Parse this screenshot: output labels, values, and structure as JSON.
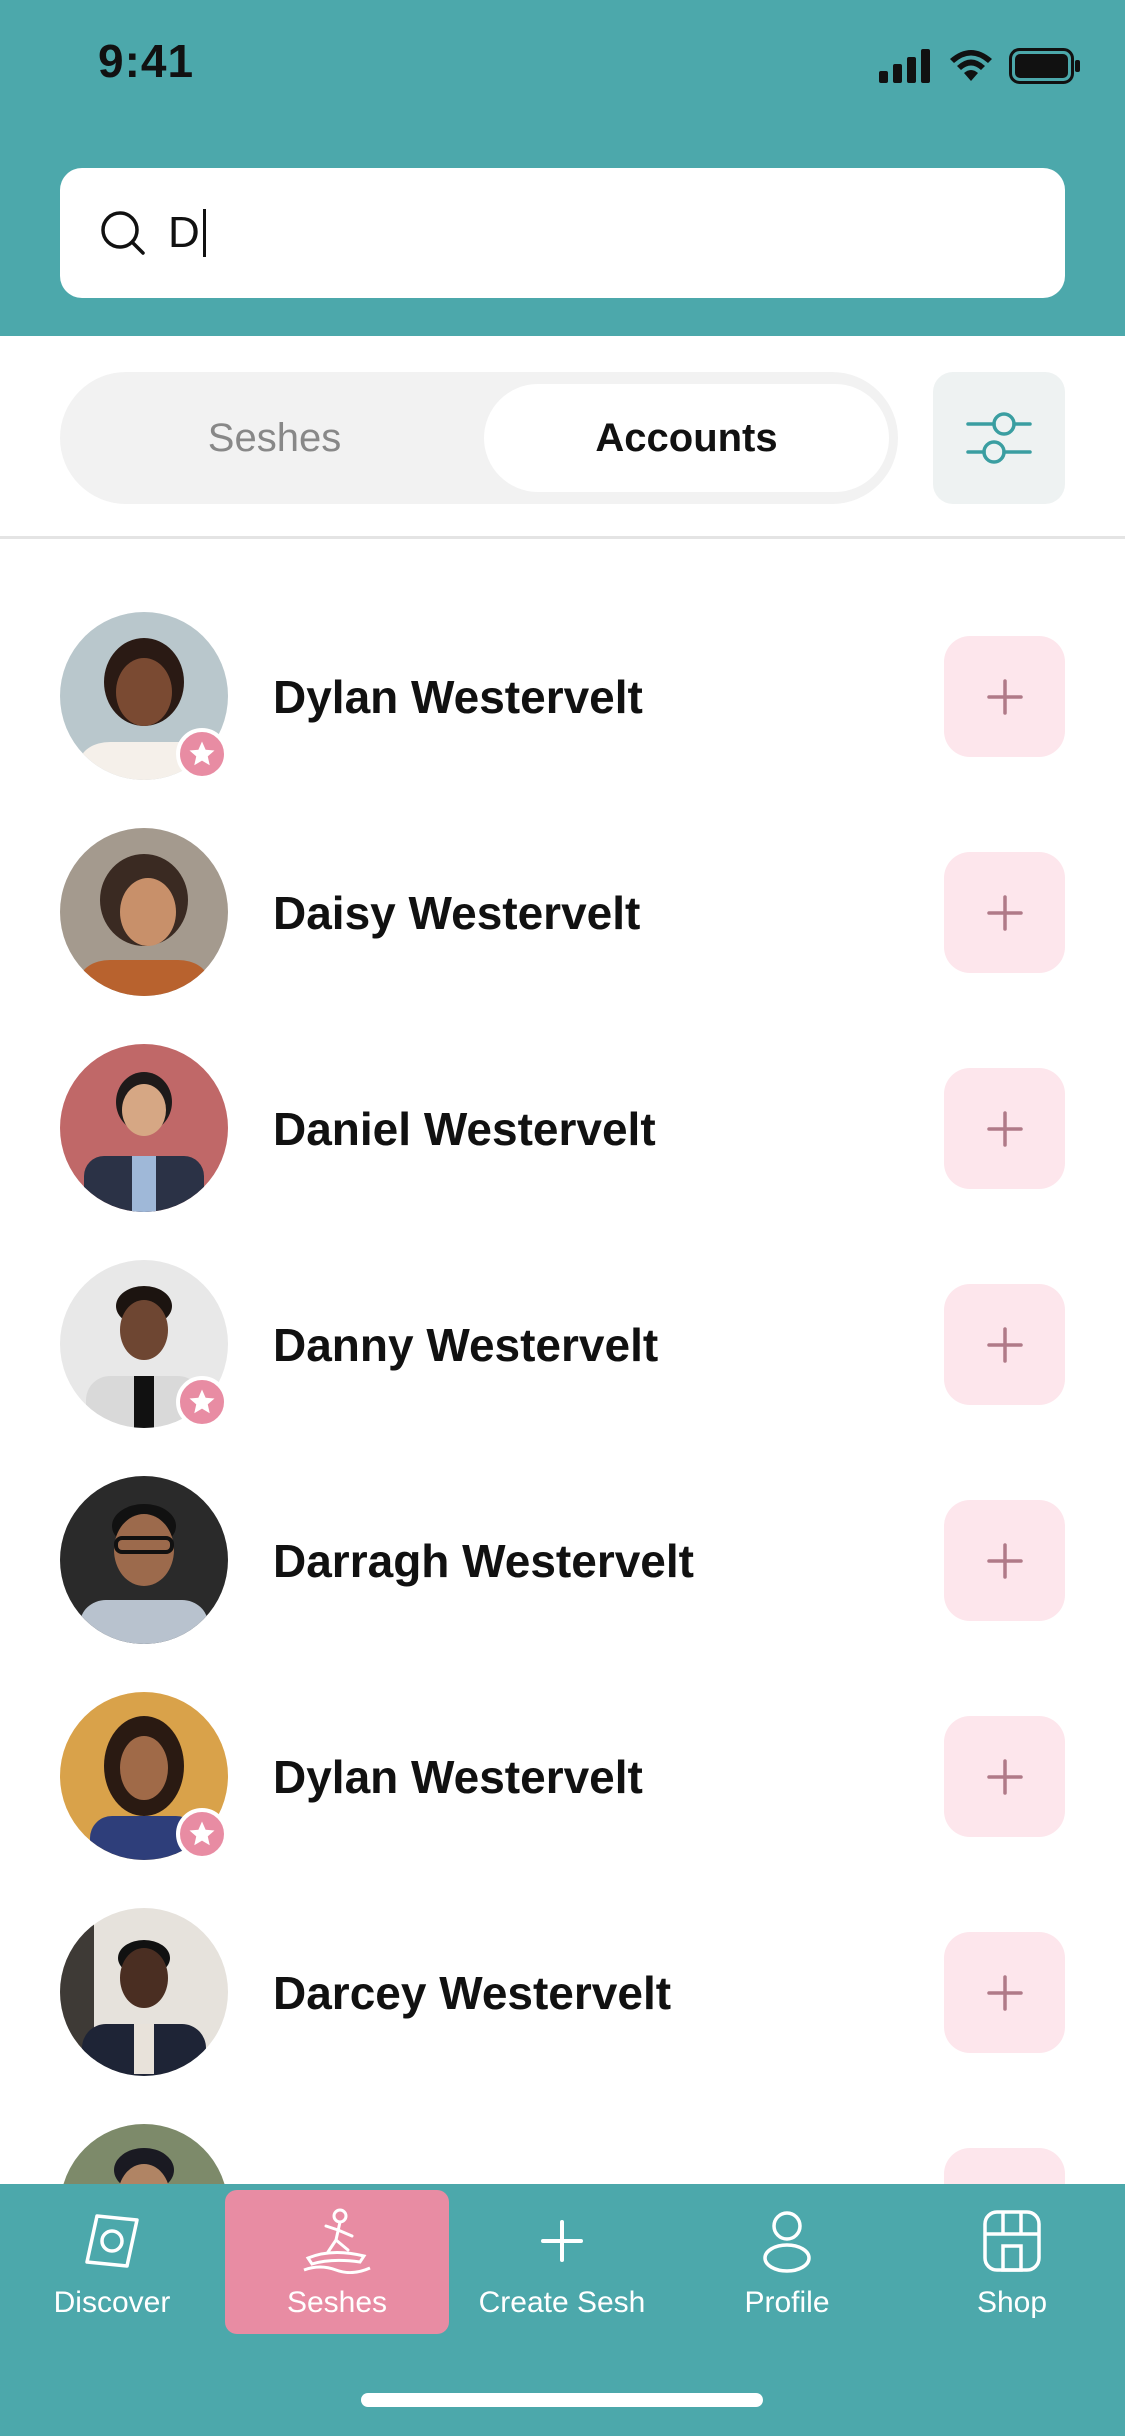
{
  "status_bar": {
    "time": "9:41"
  },
  "search": {
    "query": "D"
  },
  "segments": {
    "left": "Seshes",
    "right": "Accounts",
    "selected": "Accounts"
  },
  "accounts": [
    {
      "name": "Dylan Westervelt",
      "starred": true
    },
    {
      "name": "Daisy Westervelt",
      "starred": false
    },
    {
      "name": "Daniel Westervelt",
      "starred": false
    },
    {
      "name": "Danny Westervelt",
      "starred": true
    },
    {
      "name": "Darragh Westervelt",
      "starred": false
    },
    {
      "name": "Dylan Westervelt",
      "starred": true
    },
    {
      "name": "Darcey Westervelt",
      "starred": false
    }
  ],
  "tabbar": {
    "items": [
      {
        "label": "Discover",
        "icon": "compass-icon"
      },
      {
        "label": "Seshes",
        "icon": "surfer-icon"
      },
      {
        "label": "Create Sesh",
        "icon": "plus-icon"
      },
      {
        "label": "Profile",
        "icon": "person-icon"
      },
      {
        "label": "Shop",
        "icon": "store-icon"
      }
    ],
    "active": "Seshes"
  },
  "colors": {
    "header": "#4ca8ab",
    "accent_pink": "#e88ca3",
    "add_button_bg": "#fde6ec"
  }
}
